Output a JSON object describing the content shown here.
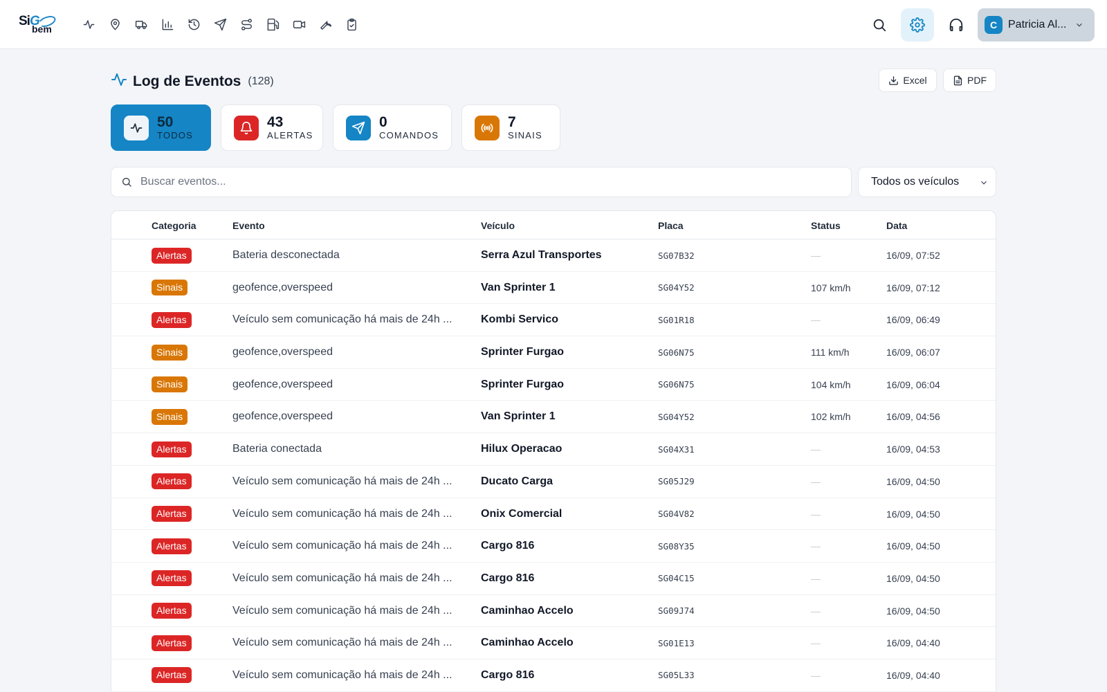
{
  "app": {
    "logo_top": "Si",
    "logo_go": "G",
    "logo_bottom": "bem"
  },
  "nav": {
    "icons": [
      "activity-icon",
      "map-pin-icon",
      "truck-icon",
      "bar-chart-icon",
      "history-icon",
      "send-icon",
      "route-icon",
      "fuel-icon",
      "video-icon",
      "wrench-icon",
      "clipboard-check-icon"
    ]
  },
  "user": {
    "initial": "C",
    "name": "Patricia Al..."
  },
  "page": {
    "title": "Log de Eventos",
    "count": "(128)",
    "excel_label": "Excel",
    "pdf_label": "PDF"
  },
  "stats": [
    {
      "value": "50",
      "label": "TODOS",
      "icon": "activity-icon",
      "color": "#1585c5"
    },
    {
      "value": "43",
      "label": "ALERTAS",
      "icon": "bell-icon",
      "color": "#dc2626"
    },
    {
      "value": "0",
      "label": "COMANDOS",
      "icon": "send-icon",
      "color": "#1585c5"
    },
    {
      "value": "7",
      "label": "SINAIS",
      "icon": "signal-icon",
      "color": "#d97706"
    }
  ],
  "search": {
    "placeholder": "Buscar eventos...",
    "value": ""
  },
  "vehicle_filter": {
    "selected": "Todos os veículos"
  },
  "table": {
    "headers": {
      "category": "Categoria",
      "event": "Evento",
      "vehicle": "Veículo",
      "plate": "Placa",
      "status": "Status",
      "date": "Data"
    },
    "rows": [
      {
        "category": "Alertas",
        "type": "alert",
        "event": "Bateria desconectada",
        "vehicle": "Serra Azul Transportes",
        "plate": "SG07B32",
        "status": "—",
        "date": "16/09, 07:52"
      },
      {
        "category": "Sinais",
        "type": "signal",
        "event": "geofence,overspeed",
        "vehicle": "Van Sprinter 1",
        "plate": "SG04Y52",
        "status": "107 km/h",
        "date": "16/09, 07:12"
      },
      {
        "category": "Alertas",
        "type": "alert",
        "event": "Veículo sem comunicação há mais de 24h ...",
        "vehicle": "Kombi Servico",
        "plate": "SG01R18",
        "status": "—",
        "date": "16/09, 06:49"
      },
      {
        "category": "Sinais",
        "type": "signal",
        "event": "geofence,overspeed",
        "vehicle": "Sprinter Furgao",
        "plate": "SG06N75",
        "status": "111 km/h",
        "date": "16/09, 06:07"
      },
      {
        "category": "Sinais",
        "type": "signal",
        "event": "geofence,overspeed",
        "vehicle": "Sprinter Furgao",
        "plate": "SG06N75",
        "status": "104 km/h",
        "date": "16/09, 06:04"
      },
      {
        "category": "Sinais",
        "type": "signal",
        "event": "geofence,overspeed",
        "vehicle": "Van Sprinter 1",
        "plate": "SG04Y52",
        "status": "102 km/h",
        "date": "16/09, 04:56"
      },
      {
        "category": "Alertas",
        "type": "alert",
        "event": "Bateria conectada",
        "vehicle": "Hilux Operacao",
        "plate": "SG04X31",
        "status": "—",
        "date": "16/09, 04:53"
      },
      {
        "category": "Alertas",
        "type": "alert",
        "event": "Veículo sem comunicação há mais de 24h ...",
        "vehicle": "Ducato Carga",
        "plate": "SG05J29",
        "status": "—",
        "date": "16/09, 04:50"
      },
      {
        "category": "Alertas",
        "type": "alert",
        "event": "Veículo sem comunicação há mais de 24h ...",
        "vehicle": "Onix Comercial",
        "plate": "SG04V82",
        "status": "—",
        "date": "16/09, 04:50"
      },
      {
        "category": "Alertas",
        "type": "alert",
        "event": "Veículo sem comunicação há mais de 24h ...",
        "vehicle": "Cargo 816",
        "plate": "SG08Y35",
        "status": "—",
        "date": "16/09, 04:50"
      },
      {
        "category": "Alertas",
        "type": "alert",
        "event": "Veículo sem comunicação há mais de 24h ...",
        "vehicle": "Cargo 816",
        "plate": "SG04C15",
        "status": "—",
        "date": "16/09, 04:50"
      },
      {
        "category": "Alertas",
        "type": "alert",
        "event": "Veículo sem comunicação há mais de 24h ...",
        "vehicle": "Caminhao Accelo",
        "plate": "SG09J74",
        "status": "—",
        "date": "16/09, 04:50"
      },
      {
        "category": "Alertas",
        "type": "alert",
        "event": "Veículo sem comunicação há mais de 24h ...",
        "vehicle": "Caminhao Accelo",
        "plate": "SG01E13",
        "status": "—",
        "date": "16/09, 04:40"
      },
      {
        "category": "Alertas",
        "type": "alert",
        "event": "Veículo sem comunicação há mais de 24h ...",
        "vehicle": "Cargo 816",
        "plate": "SG05L33",
        "status": "—",
        "date": "16/09, 04:40"
      }
    ]
  }
}
